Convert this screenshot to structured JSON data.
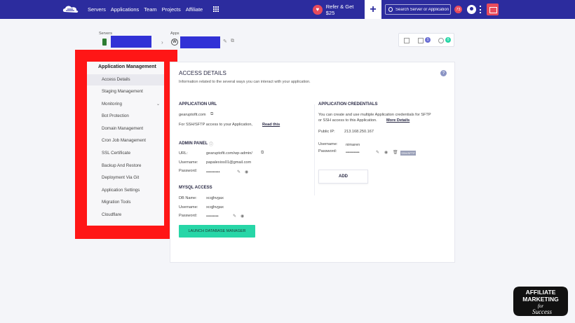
{
  "nav": {
    "items": [
      "Servers",
      "Applications",
      "Team",
      "Projects",
      "Affiliate"
    ],
    "refer_label": "Refer & Get $25",
    "search_placeholder": "Search Server or Application",
    "notification_count": "73"
  },
  "breadcrumb": {
    "servers_label": "Servers",
    "apps_label": "Apps"
  },
  "toolbox": {
    "mail_badge": "1",
    "users_badge": "0"
  },
  "sidebar": {
    "title": "Application Management",
    "items": [
      {
        "label": "Access Details",
        "active": true
      },
      {
        "label": "Staging Management"
      },
      {
        "label": "Monitoring",
        "has_chevron": true
      },
      {
        "label": "Bot Protection"
      },
      {
        "label": "Domain Management"
      },
      {
        "label": "Cron Job Management"
      },
      {
        "label": "SSL Certificate"
      },
      {
        "label": "Backup And Restore"
      },
      {
        "label": "Deployment Via Git"
      },
      {
        "label": "Application Settings"
      },
      {
        "label": "Migration Tools"
      },
      {
        "label": "Cloudflare"
      }
    ]
  },
  "access": {
    "title": "ACCESS DETAILS",
    "subtitle": "Information related to the several ways you can interact with your application.",
    "app_url": {
      "heading": "APPLICATION URL",
      "url": "gearuptofit.com",
      "note": "For SSH/SFTP access to your Application,",
      "read_link": "Read this"
    },
    "admin": {
      "heading": "ADMIN PANEL",
      "url_label": "URL:",
      "url_value": "gearuptofit.com/wp-admin/",
      "username_label": "Username:",
      "username_value": "papalexios01@gmail.com",
      "password_label": "Password:",
      "password_value": "••••••••••"
    },
    "mysql": {
      "heading": "MYSQL ACCESS",
      "db_label": "DB Name:",
      "db_value": "xcqjhvgax",
      "username_label": "Username:",
      "username_value": "xcqjhvgax",
      "password_label": "Password:",
      "password_value": "•••••••••",
      "launch_button": "LAUNCH DATABASE MANAGER"
    },
    "credentials": {
      "heading": "APPLICATION CREDENTIALS",
      "desc_line1": "You can create and use multiple Application credentials for SFTP",
      "desc_line2": "or SSH access to this Application.",
      "more_link": "More Details",
      "public_ip_label": "Public IP:",
      "public_ip_value": "213.168.250.167",
      "username_label": "Username:",
      "username_value": "nimaren",
      "password_label": "Password:",
      "password_value": "••••••••••",
      "ssh_badge": "SSH/SFTP",
      "add_button": "ADD"
    }
  },
  "watermark": {
    "line1": "AFFILIATE",
    "line2": "MARKETING",
    "line3": "for",
    "line4": "Success"
  },
  "colors": {
    "nav_bg": "#2c2c9e",
    "highlight_red": "#ff1616",
    "launch_green": "#27d6a7",
    "redaction_blue": "#3131d6"
  }
}
